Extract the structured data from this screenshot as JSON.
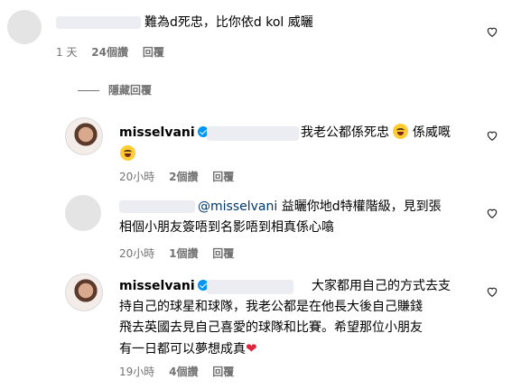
{
  "comments": [
    {
      "text": "難為d死忠，比你依d kol 威曬",
      "time": "1 天",
      "likes": "24個讚",
      "reply": "回覆"
    }
  ],
  "hide_replies": "隱藏回覆",
  "replies": [
    {
      "username": "misselvani",
      "text": "我老公都係死忠",
      "text2": "係威嘅",
      "time": "20小時",
      "likes": "2個讚",
      "reply": "回覆"
    },
    {
      "mention": "@misselvani",
      "line1": "益曬你地d特權階級，見到張",
      "line2": "相個小朋友簽唔到名影唔到相真係心噏",
      "time": "20小時",
      "likes": "1個讚",
      "reply": "回覆"
    },
    {
      "username": "misselvani",
      "line1": "大家都用自己的方式去支",
      "line2": "持自己的球星和球隊，我老公都是在他長大後自己賺錢",
      "line3": "飛去英國去見自己喜愛的球隊和比賽。希望那位小朋友",
      "line4": "有一日都可以夢想成真",
      "time": "19小時",
      "likes": "4個讚",
      "reply": "回覆"
    }
  ],
  "icons": {
    "like": "heart-outline-icon",
    "verified": "verified-badge-icon",
    "emoji_laugh": "grinning-sweat-emoji",
    "emoji_tongue": "tongue-emoji",
    "emoji_heart": "red-heart-emoji"
  }
}
